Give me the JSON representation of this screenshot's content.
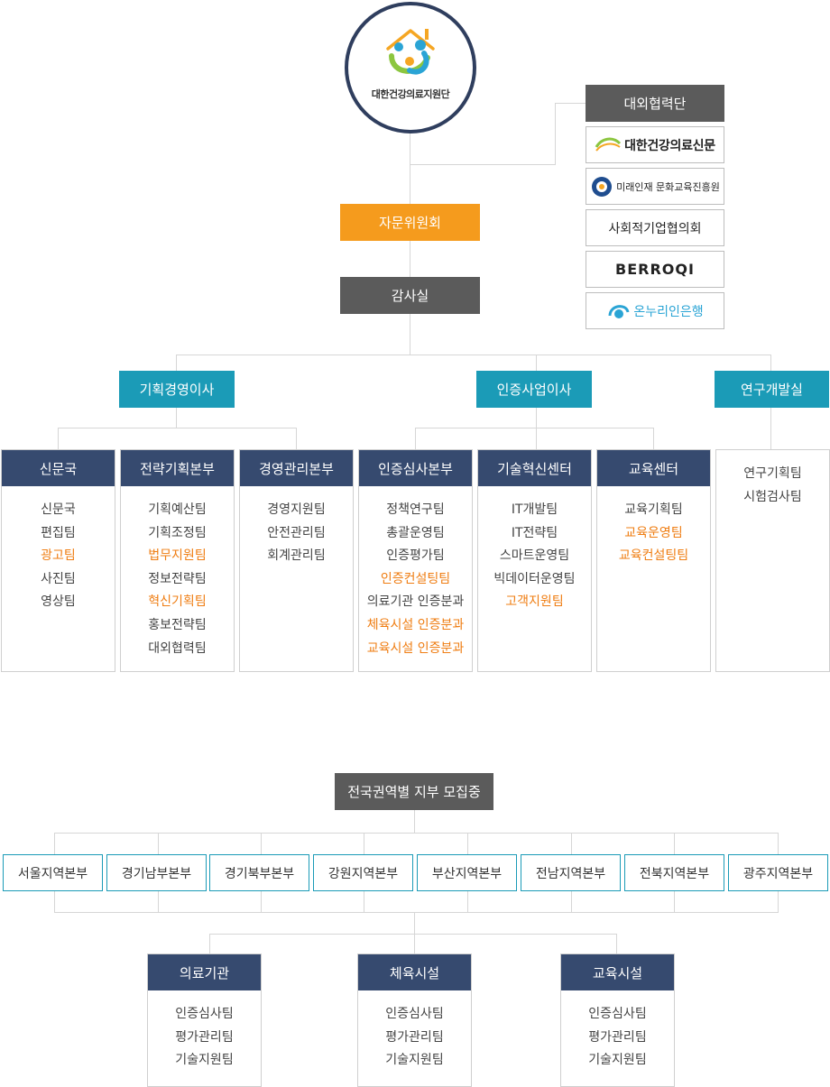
{
  "logo": {
    "name": "대한건강의료지원단"
  },
  "top": {
    "advisory": "자문위원회",
    "audit": "감사실",
    "external": "대외협력단"
  },
  "partners": [
    {
      "name": "대한건강의료신문",
      "badge": "khmnews"
    },
    {
      "name": "미래인재 문화교육진흥원",
      "badge": "mirae"
    },
    {
      "name": "사회적기업협의회"
    },
    {
      "name": "BERROQI"
    },
    {
      "name": "온누리인은행"
    }
  ],
  "directors": [
    "기획경영이사",
    "인증사업이사",
    "연구개발실"
  ],
  "departments": [
    {
      "title": "신문국",
      "items": [
        {
          "t": "신문국",
          "hl": false
        },
        {
          "t": "편집팀",
          "hl": false
        },
        {
          "t": "광고팀",
          "hl": true
        },
        {
          "t": "사진팀",
          "hl": false
        },
        {
          "t": "영상팀",
          "hl": false
        }
      ]
    },
    {
      "title": "전략기획본부",
      "items": [
        {
          "t": "기획예산팀",
          "hl": false
        },
        {
          "t": "기획조정팀",
          "hl": false
        },
        {
          "t": "법무지원팀",
          "hl": true
        },
        {
          "t": "정보전략팀",
          "hl": false
        },
        {
          "t": "혁신기획팀",
          "hl": true
        },
        {
          "t": "홍보전략팀",
          "hl": false
        },
        {
          "t": "대외협력팀",
          "hl": false
        }
      ]
    },
    {
      "title": "경영관리본부",
      "items": [
        {
          "t": "경영지원팀",
          "hl": false
        },
        {
          "t": "안전관리팀",
          "hl": false
        },
        {
          "t": "회계관리팀",
          "hl": false
        }
      ]
    },
    {
      "title": "인증심사본부",
      "items": [
        {
          "t": "정책연구팀",
          "hl": false
        },
        {
          "t": "총괄운영팀",
          "hl": false
        },
        {
          "t": "인증평가팀",
          "hl": false
        },
        {
          "t": "인증컨설팅팀",
          "hl": true
        },
        {
          "t": "의료기관 인증분과",
          "hl": false
        },
        {
          "t": "체육시설 인증분과",
          "hl": true
        },
        {
          "t": "교육시설 인증분과",
          "hl": true
        }
      ]
    },
    {
      "title": "기술혁신센터",
      "items": [
        {
          "t": "IT개발팀",
          "hl": false
        },
        {
          "t": "IT전략팀",
          "hl": false
        },
        {
          "t": "스마트운영팀",
          "hl": false
        },
        {
          "t": "빅데이터운영팀",
          "hl": false
        },
        {
          "t": "고객지원팀",
          "hl": true
        }
      ]
    },
    {
      "title": "교육센터",
      "items": [
        {
          "t": "교육기획팀",
          "hl": false
        },
        {
          "t": "교육운영팀",
          "hl": true
        },
        {
          "t": "교육컨설팅팀",
          "hl": true
        }
      ]
    },
    {
      "title": "",
      "items": [
        {
          "t": "연구기획팀",
          "hl": false
        },
        {
          "t": "시험검사팀",
          "hl": false
        }
      ]
    }
  ],
  "branch": {
    "title": "전국권역별 지부 모집중",
    "regions": [
      "서울지역본부",
      "경기남부본부",
      "경기북부본부",
      "강원지역본부",
      "부산지역본부",
      "전남지역본부",
      "전북지역본부",
      "광주지역본부"
    ],
    "facilities": [
      {
        "title": "의료기관",
        "items": [
          "인증심사팀",
          "평가관리팀",
          "기술지원팀"
        ]
      },
      {
        "title": "체육시설",
        "items": [
          "인증심사팀",
          "평가관리팀",
          "기술지원팀"
        ]
      },
      {
        "title": "교육시설",
        "items": [
          "인증심사팀",
          "평가관리팀",
          "기술지원팀"
        ]
      }
    ]
  },
  "colors": {
    "navy": "#364a6f",
    "teal": "#1b9bb7",
    "orange": "#f59b1d",
    "gray": "#5b5b5b",
    "highlight": "#ef7d12"
  }
}
